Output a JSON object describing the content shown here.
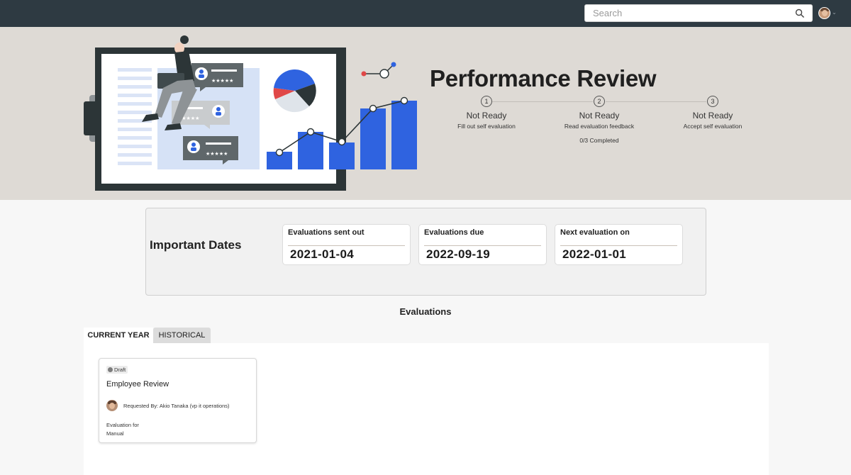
{
  "header": {
    "search": {
      "placeholder": "Search"
    },
    "user_menu": {
      "icon": "user-avatar",
      "chevron": "chevron-down-icon"
    }
  },
  "hero": {
    "title": "Performance Review",
    "steps": [
      {
        "number": "1",
        "status": "Not Ready",
        "description": "Fill out self evaluation",
        "extra": ""
      },
      {
        "number": "2",
        "status": "Not Ready",
        "description": "Read evaluation feedback",
        "extra": "0/3 Completed"
      },
      {
        "number": "3",
        "status": "Not Ready",
        "description": "Accept self evaluation",
        "extra": ""
      }
    ]
  },
  "important_dates": {
    "label": "Important Dates",
    "cards": [
      {
        "label": "Evaluations sent out",
        "value": "2021-01-04"
      },
      {
        "label": "Evaluations due",
        "value": "2022-09-19"
      },
      {
        "label": "Next evaluation on",
        "value": "2022-01-01"
      }
    ]
  },
  "evaluations": {
    "title": "Evaluations",
    "tabs": [
      {
        "label": "CURRENT YEAR",
        "active": true
      },
      {
        "label": "HISTORICAL",
        "active": false
      }
    ],
    "cards": [
      {
        "status": "Draft",
        "title": "Employee Review",
        "requested_by": "Requested By: Akio Tanaka (vp it operations)",
        "evaluation_for_label": "Evaluation for",
        "evaluation_for_value": "Manual"
      }
    ]
  },
  "colors": {
    "topbar": "#2e3a42",
    "hero_bg": "#dedad5",
    "accent_blue": "#2f63e0",
    "accent_red": "#e04848"
  }
}
